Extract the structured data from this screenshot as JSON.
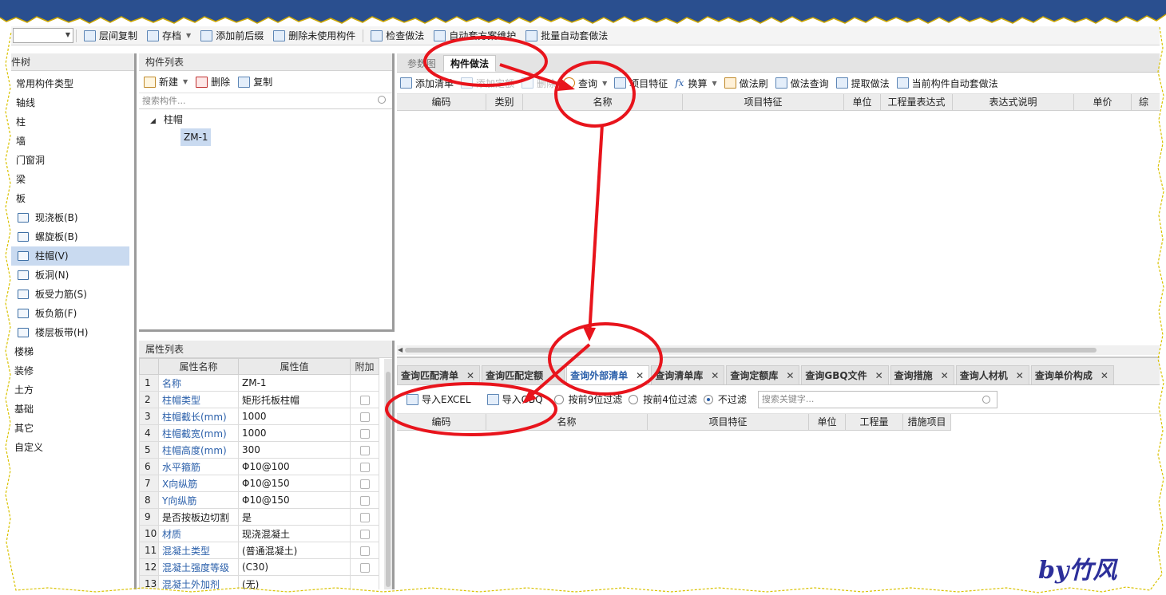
{
  "toolbar": {
    "items": [
      "层间复制",
      "存档",
      "添加前后缀",
      "删除未使用构件",
      "检查做法",
      "自动套方案维护",
      "批量自动套做法"
    ]
  },
  "left_tree": {
    "header": "构件树",
    "items": [
      "常用构件类型",
      "轴线",
      "柱",
      "墙",
      "门窗洞",
      "梁",
      "板"
    ],
    "sub_items": [
      "现浇板(B)",
      "螺旋板(B)",
      "柱帽(V)",
      "板洞(N)",
      "板受力筋(S)",
      "板负筋(F)",
      "楼层板带(H)"
    ],
    "selected_sub": "柱帽(V)",
    "after_items": [
      "楼梯",
      "装修",
      "土方",
      "基础",
      "其它",
      "自定义"
    ]
  },
  "component_list": {
    "header": "构件列表",
    "new_label": "新建",
    "delete_label": "删除",
    "copy_label": "复制",
    "search_placeholder": "搜索构件...",
    "root": "柱帽",
    "child": "ZM-1"
  },
  "property_list": {
    "header": "属性列表",
    "columns": [
      "属性名称",
      "属性值",
      "附加"
    ],
    "rows": [
      {
        "num": "1",
        "name": "名称",
        "value": "ZM-1",
        "blue": true,
        "check": false
      },
      {
        "num": "2",
        "name": "柱帽类型",
        "value": "矩形托板柱帽",
        "blue": true,
        "check": true
      },
      {
        "num": "3",
        "name": "柱帽截长(mm)",
        "value": "1000",
        "blue": true,
        "check": true
      },
      {
        "num": "4",
        "name": "柱帽截宽(mm)",
        "value": "1000",
        "blue": true,
        "check": true
      },
      {
        "num": "5",
        "name": "柱帽高度(mm)",
        "value": "300",
        "blue": true,
        "check": true
      },
      {
        "num": "6",
        "name": "水平箍筋",
        "value": "Φ10@100",
        "blue": true,
        "check": true
      },
      {
        "num": "7",
        "name": "X向纵筋",
        "value": "Φ10@150",
        "blue": true,
        "check": true
      },
      {
        "num": "8",
        "name": "Y向纵筋",
        "value": "Φ10@150",
        "blue": true,
        "check": true
      },
      {
        "num": "9",
        "name": "是否按板边切割",
        "value": "是",
        "blue": false,
        "check": true
      },
      {
        "num": "10",
        "name": "材质",
        "value": "现浇混凝土",
        "blue": true,
        "check": true
      },
      {
        "num": "11",
        "name": "混凝土类型",
        "value": "(普通混凝土)",
        "blue": true,
        "check": true
      },
      {
        "num": "12",
        "name": "混凝土强度等级",
        "value": "(C30)",
        "blue": true,
        "check": true
      },
      {
        "num": "13",
        "name": "混凝土外加剂",
        "value": "(无)",
        "blue": true,
        "check": false
      }
    ]
  },
  "main_tabs": [
    "参数图",
    "构件做法"
  ],
  "main_active_tab": "构件做法",
  "method_toolbar": [
    "添加清单",
    "添加定额",
    "删除",
    "查询",
    "项目特征",
    "换算",
    "做法刷",
    "做法查询",
    "提取做法",
    "当前构件自动套做法"
  ],
  "method_grid_columns": [
    "编码",
    "类别",
    "名称",
    "项目特征",
    "单位",
    "工程量表达式",
    "表达式说明",
    "单价",
    "综"
  ],
  "bottom_tabs": [
    "查询匹配清单",
    "查询匹配定额",
    "查询外部清单",
    "查询清单库",
    "查询定额库",
    "查询GBQ文件",
    "查询措施",
    "查询人材机",
    "查询单价构成"
  ],
  "bottom_active_tab": "查询外部清单",
  "import_excel_label": "导入EXCEL",
  "import_gbq_label": "导入GBQ",
  "filters": [
    "按前9位过滤",
    "按前4位过滤",
    "不过滤"
  ],
  "filter_selected": "不过滤",
  "keyword_placeholder": "搜索关键字...",
  "bottom_grid_columns": [
    "编码",
    "名称",
    "项目特征",
    "单位",
    "工程量",
    "措施项目"
  ],
  "signature": "by竹风",
  "colors": {
    "annotation_red": "#e8141c",
    "accent_blue": "#2a5faa",
    "wave_blue": "#2a4f8f",
    "selected_bg": "#c9daf0"
  }
}
